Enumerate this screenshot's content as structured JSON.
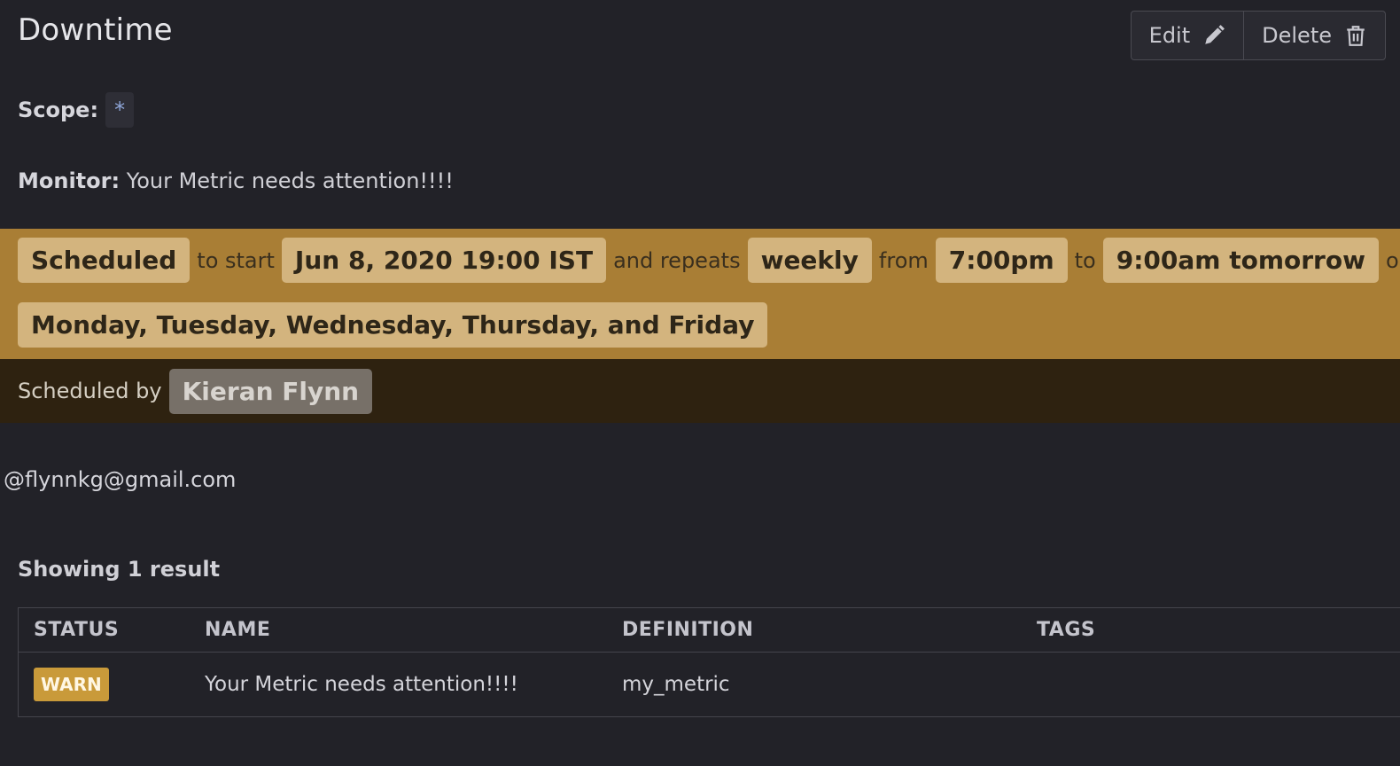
{
  "header": {
    "title": "Downtime",
    "edit_label": "Edit",
    "delete_label": "Delete"
  },
  "details": {
    "scope_label": "Scope:",
    "scope_value": "*",
    "monitor_label": "Monitor:",
    "monitor_value": "Your Metric needs attention!!!!"
  },
  "schedule": {
    "status": "Scheduled",
    "to_start_text": "to start",
    "start_datetime": "Jun 8, 2020 19:00 IST",
    "repeats_text": "and repeats",
    "frequency": "weekly",
    "from_text": "from",
    "from_time": "7:00pm",
    "to_text": "to",
    "to_time": "9:00am tomorrow",
    "on_text": "on",
    "days": "Monday, Tuesday, Wednesday, Thursday, and Friday"
  },
  "byline": {
    "label": "Scheduled by",
    "user": "Kieran Flynn"
  },
  "message": "@flynnkg@gmail.com",
  "results": {
    "count_text": "Showing 1 result",
    "columns": [
      "STATUS",
      "NAME",
      "DEFINITION",
      "TAGS"
    ],
    "rows": [
      {
        "status": "WARN",
        "name": "Your Metric needs attention!!!!",
        "definition": "my_metric",
        "tags": ""
      }
    ]
  },
  "colors": {
    "background": "#222228",
    "schedule_band": "#a97e35",
    "byline_band": "#2e2210",
    "warn": "#c99a3a"
  },
  "icons": {
    "edit": "pencil-icon",
    "delete": "trash-icon"
  }
}
